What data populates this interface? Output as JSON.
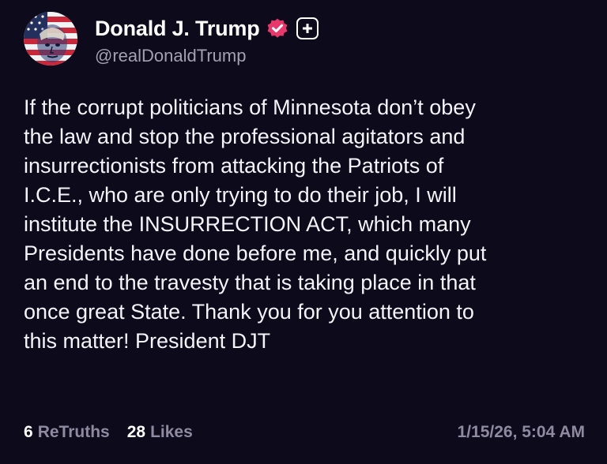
{
  "author": {
    "display_name": "Donald J. Trump",
    "handle": "@realDonaldTrump",
    "verified_icon": "verified-badge-icon",
    "follow_icon": "plus-icon",
    "avatar_icon": "flag-portrait-avatar"
  },
  "post": {
    "lines": [
      "If the corrupt politicians of Minnesota don’t obey",
      "the law and stop the professional agitators and",
      "insurrectionists from attacking the Patriots of",
      "I.C.E., who are only trying to do their job, I will",
      "institute the INSURRECTION ACT, which many",
      "Presidents have done before me, and quickly put",
      "an end to the travesty that is taking place in that",
      "once great State. Thank you for you attention to",
      "this matter! President DJT"
    ]
  },
  "footer": {
    "retruths_count": "6",
    "retruths_label": "ReTruths",
    "likes_count": "28",
    "likes_label": "Likes",
    "timestamp": "1/15/26, 5:04 AM"
  },
  "colors": {
    "background": "#0d0a1c",
    "text": "#ffffff",
    "muted": "#8f8aa0",
    "verified": "#e9376b"
  }
}
